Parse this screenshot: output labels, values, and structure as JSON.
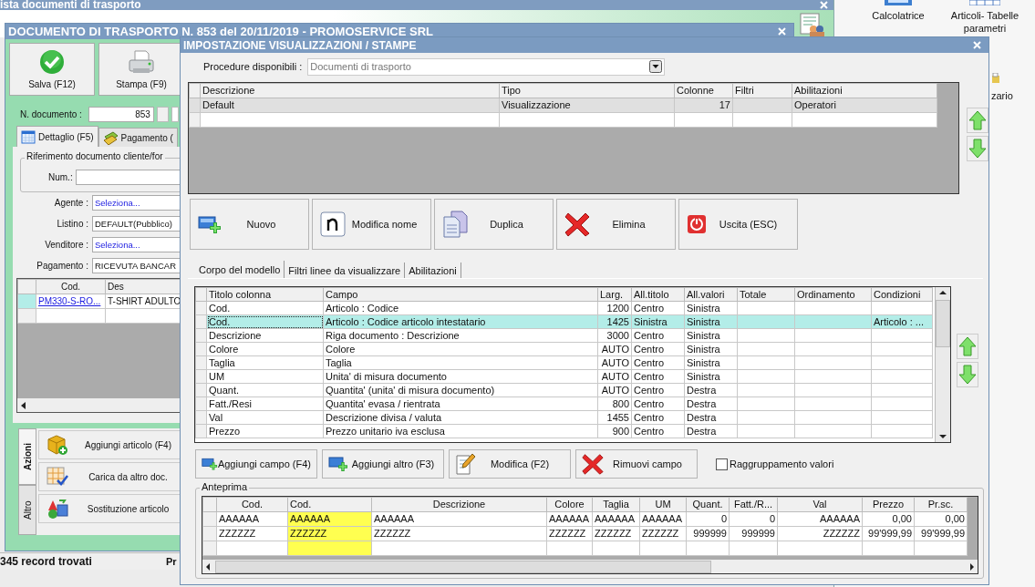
{
  "background_window": {
    "title": "ista documenti di trasporto"
  },
  "desktop_icons": [
    {
      "label": "Calcolatrice",
      "kind": "calculator"
    },
    {
      "label": "Articoli- Tabelle parametri",
      "kind": "grid"
    },
    {
      "label": "zario",
      "kind": "folder"
    }
  ],
  "document_window": {
    "title": "DOCUMENTO DI TRASPORTO N. 853 del 20/11/2019 - PROMOSERVICE SRL",
    "toolbar": [
      {
        "label": "Salva (F12)",
        "kind": "save"
      },
      {
        "label": "Stampa (F9)",
        "kind": "print"
      }
    ],
    "number": {
      "label": "N. documento :",
      "value": "853"
    },
    "tabs": [
      {
        "label": "Dettaglio (F5)",
        "kind": "calendar",
        "selected": true
      },
      {
        "label": "Pagamento (",
        "kind": "money",
        "selected": false
      }
    ],
    "reference": {
      "title": "Riferimento documento cliente/for",
      "label": "Num.:"
    },
    "fields": [
      {
        "label": "Agente :",
        "value": "Seleziona...",
        "kind": "link"
      },
      {
        "label": "Listino :",
        "value": "DEFAULT(Pubblico)",
        "kind": "text"
      },
      {
        "label": "Venditore :",
        "value": "Seleziona...",
        "kind": "link"
      },
      {
        "label": "Pagamento :",
        "value": "RICEVUTA BANCAR",
        "kind": "text"
      }
    ],
    "grid": {
      "columns": [
        "Cod.",
        "Des"
      ],
      "rows": [
        {
          "cells": [
            "PM330-S-RO...",
            "T-SHIRT ADULTO"
          ],
          "selected": true
        }
      ]
    },
    "side_tabs": [
      {
        "label": "Azioni",
        "selected": true
      },
      {
        "label": "Altro",
        "selected": false
      }
    ],
    "actions": [
      {
        "label": "Aggiungi articolo (F4)",
        "kind": "box"
      },
      {
        "label": "Carica da altro doc.",
        "kind": "table"
      },
      {
        "label": "Sostituzione articolo",
        "kind": "swap"
      }
    ],
    "status": [
      "345 record trovati",
      "Pr"
    ]
  },
  "dialog": {
    "title": "IMPOSTAZIONE VISUALIZZAZIONI / STAMPE",
    "procedure": {
      "label": "Procedure disponibili :",
      "value": "Documenti di trasporto"
    },
    "models": {
      "columns": [
        "Descrizione",
        "Tipo",
        "Colonne",
        "Filtri",
        "Abilitazioni"
      ],
      "rows": [
        {
          "cells": [
            "Default",
            "Visualizzazione",
            "17",
            "",
            "Operatori"
          ],
          "selected": true
        }
      ]
    },
    "buttons": [
      {
        "label": "Nuovo",
        "kind": "new"
      },
      {
        "label": "Modifica nome",
        "kind": "rename"
      },
      {
        "label": "Duplica",
        "kind": "copy"
      },
      {
        "label": "Elimina",
        "kind": "delete"
      },
      {
        "label": "Uscita (ESC)",
        "kind": "exit"
      }
    ],
    "tabs": [
      {
        "label": "Corpo del modello",
        "selected": true
      },
      {
        "label": "Filtri linee da visualizzare",
        "selected": false
      },
      {
        "label": "Abilitazioni",
        "selected": false
      }
    ],
    "fields_grid": {
      "columns": [
        "Titolo colonna",
        "Campo",
        "Larg.",
        "All.titolo",
        "All.valori",
        "Totale",
        "Ordinamento",
        "Condizioni"
      ],
      "rows": [
        {
          "cells": [
            "Cod.",
            "Articolo : Codice",
            "1200",
            "Centro",
            "Sinistra",
            "",
            "",
            ""
          ],
          "selected": false
        },
        {
          "cells": [
            "Cod.",
            "Articolo : Codice articolo intestatario",
            "1425",
            "Sinistra",
            "Sinistra",
            "",
            "",
            "Articolo : ..."
          ],
          "selected": true
        },
        {
          "cells": [
            "Descrizione",
            "Riga documento : Descrizione",
            "3000",
            "Centro",
            "Sinistra",
            "",
            "",
            ""
          ],
          "selected": false
        },
        {
          "cells": [
            "Colore",
            "Colore",
            "AUTO",
            "Centro",
            "Sinistra",
            "",
            "",
            ""
          ],
          "selected": false
        },
        {
          "cells": [
            "Taglia",
            "Taglia",
            "AUTO",
            "Centro",
            "Sinistra",
            "",
            "",
            ""
          ],
          "selected": false
        },
        {
          "cells": [
            "UM",
            "Unita' di misura documento",
            "AUTO",
            "Centro",
            "Sinistra",
            "",
            "",
            ""
          ],
          "selected": false
        },
        {
          "cells": [
            "Quant.",
            "Quantita' (unita' di misura documento)",
            "AUTO",
            "Centro",
            "Destra",
            "",
            "",
            ""
          ],
          "selected": false
        },
        {
          "cells": [
            "Fatt./Resi",
            "Quantita' evasa / rientrata",
            "800",
            "Centro",
            "Destra",
            "",
            "",
            ""
          ],
          "selected": false
        },
        {
          "cells": [
            "Val",
            "Descrizione divisa / valuta",
            "1455",
            "Centro",
            "Destra",
            "",
            "",
            ""
          ],
          "selected": false
        },
        {
          "cells": [
            "Prezzo",
            "Prezzo unitario iva esclusa",
            "900",
            "Centro",
            "Destra",
            "",
            "",
            ""
          ],
          "selected": false
        }
      ]
    },
    "field_buttons": [
      {
        "label": "Aggiungi campo (F4)",
        "kind": "add"
      },
      {
        "label": "Aggiungi altro (F3)",
        "kind": "add"
      },
      {
        "label": "Modifica (F2)",
        "kind": "edit"
      },
      {
        "label": "Rimuovi campo",
        "kind": "delete"
      }
    ],
    "grouping": {
      "label": "Raggruppamento valori",
      "checked": false
    },
    "preview": {
      "title": "Anteprima",
      "columns": [
        {
          "label": "Cod.",
          "highlighted": false
        },
        {
          "label": "Cod.",
          "highlighted": true
        },
        {
          "label": "Descrizione",
          "highlighted": false
        },
        {
          "label": "Colore",
          "highlighted": false
        },
        {
          "label": "Taglia",
          "highlighted": false
        },
        {
          "label": "UM",
          "highlighted": false
        },
        {
          "label": "Quant.",
          "highlighted": false
        },
        {
          "label": "Fatt./R...",
          "highlighted": false
        },
        {
          "label": "Val",
          "highlighted": false
        },
        {
          "label": "Prezzo",
          "highlighted": false
        },
        {
          "label": "Pr.sc.",
          "highlighted": false
        }
      ],
      "rows": [
        [
          "AAAAAA",
          "AAAAAA",
          "AAAAAA",
          "AAAAAA",
          "AAAAAA",
          "AAAAAA",
          "0",
          "0",
          "AAAAAA",
          "0,00",
          "0,00"
        ],
        [
          "ZZZZZZ",
          "ZZZZZZ",
          "ZZZZZZ",
          "ZZZZZZ",
          "ZZZZZZ",
          "ZZZZZZ",
          "999999",
          "999999",
          "ZZZZZZ",
          "99'999,99",
          "99'999,99"
        ]
      ]
    }
  }
}
